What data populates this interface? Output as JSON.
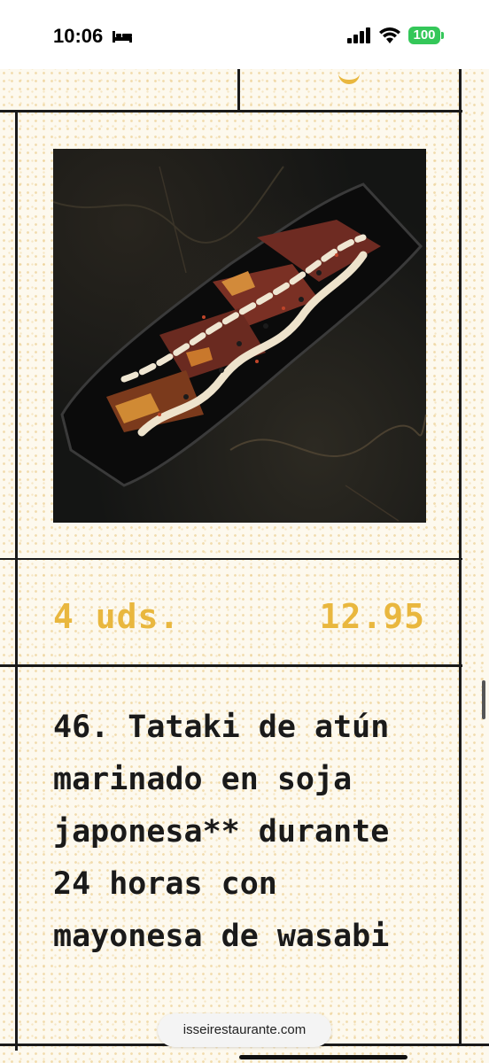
{
  "status_bar": {
    "time": "10:06",
    "battery": "100",
    "icons": [
      "bed-icon",
      "signal-icon",
      "wifi-icon",
      "battery-icon"
    ],
    "battery_color": "#34c759"
  },
  "menu_item": {
    "quantity": "4 uds.",
    "price": "12.95",
    "title": "46. Tataki de atún marinado en soja japonesa** durante 24 horas con mayonesa de wasabi",
    "accent_color": "#e9b73e",
    "text_color": "#1a1a1a"
  },
  "browser": {
    "url": "isseirestaurante.com"
  }
}
